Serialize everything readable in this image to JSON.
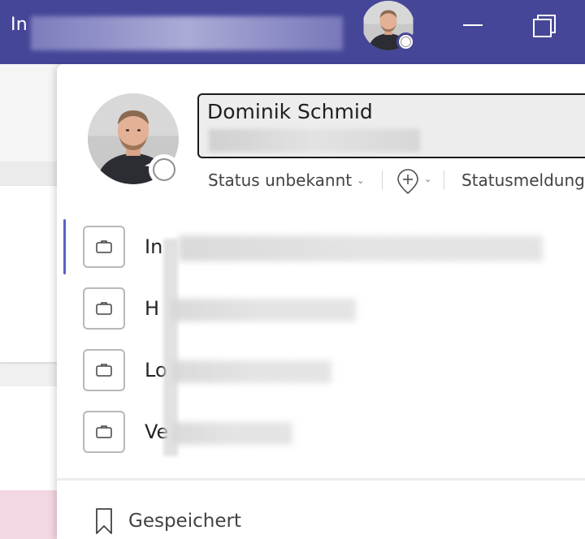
{
  "titlebar": {
    "app_title_visible": "In",
    "background_color": "#464699"
  },
  "profile": {
    "name": "Dominik Schmid",
    "status_label": "Status unbekannt",
    "status_message_label": "Statusmeldung",
    "presence": "unknown"
  },
  "accounts": [
    {
      "label_visible": "In",
      "active": true
    },
    {
      "label_visible": "H",
      "active": false
    },
    {
      "label_visible": "Lo",
      "active": false
    },
    {
      "label_visible": "Ve",
      "active": false
    }
  ],
  "saved": {
    "label": "Gespeichert"
  },
  "icons": {
    "add_status": "location-add-icon",
    "account": "briefcase-icon",
    "saved": "bookmark-icon",
    "minimize": "minimize-icon",
    "restore": "restore-icon"
  },
  "colors": {
    "accent": "#5b5fc7",
    "titlebar": "#464699"
  }
}
